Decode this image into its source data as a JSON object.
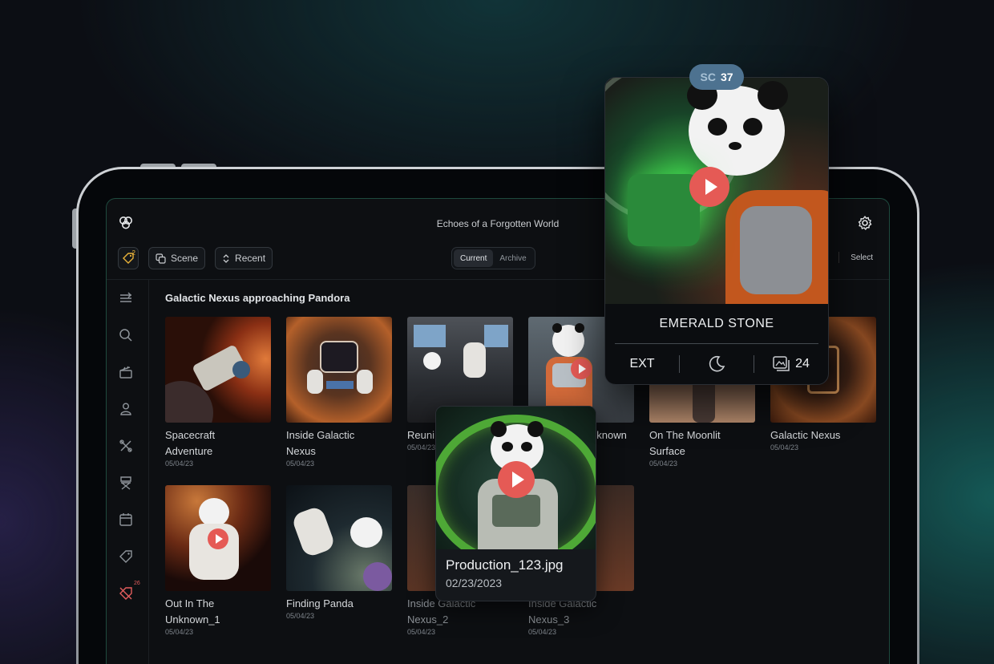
{
  "app": {
    "title": "Echoes of a Forgotten World",
    "tag_badge": "2"
  },
  "toolbar": {
    "scene_label": "Scene",
    "recent_label": "Recent",
    "segments": [
      {
        "label": "Current",
        "active": true
      },
      {
        "label": "Archive",
        "active": false
      }
    ],
    "select_label": "Select"
  },
  "sidebar": {
    "items": [
      {
        "icon": "collapse-icon"
      },
      {
        "icon": "search-icon"
      },
      {
        "icon": "clapperboard-icon"
      },
      {
        "icon": "person-icon"
      },
      {
        "icon": "tools-icon"
      },
      {
        "icon": "director-chair-icon"
      },
      {
        "icon": "calendar-icon"
      },
      {
        "icon": "tag-icon"
      },
      {
        "icon": "untag-icon",
        "badge": "26"
      }
    ]
  },
  "section": {
    "title": "Galactic Nexus approaching Pandora"
  },
  "cards": [
    {
      "title_line1": "Spacecraft",
      "title_line2": "Adventure",
      "date": "05/04/23"
    },
    {
      "title_line1": "Inside Galactic",
      "title_line2": "Nexus",
      "date": "05/04/23"
    },
    {
      "title_line1": "Reuni",
      "title_line2": "",
      "date": "05/04/23"
    },
    {
      "title_line1": "nknown",
      "title_line2": "",
      "date": ""
    },
    {
      "title_line1": "On The Moonlit",
      "title_line2": "Surface",
      "date": "05/04/23"
    },
    {
      "title_line1": "Galactic Nexus",
      "title_line2": "",
      "date": "05/04/23"
    },
    {
      "title_line1": "Out In The",
      "title_line2": "Unknown_1",
      "date": "05/04/23"
    },
    {
      "title_line1": "Finding Panda",
      "title_line2": "",
      "date": "05/04/23"
    },
    {
      "title_line1": "Inside Galactic",
      "title_line2": "Nexus_2",
      "date": "05/04/23"
    },
    {
      "title_line1": "Inside Galactic",
      "title_line2": "Nexus_3",
      "date": "05/04/23"
    }
  ],
  "production_card": {
    "filename": "Production_123.jpg",
    "date": "02/23/2023"
  },
  "scene_card": {
    "scene_label": "SC",
    "scene_number": "37",
    "title": "EMERALD STONE",
    "location": "EXT",
    "time_icon": "moon-icon",
    "image_count": "24"
  },
  "colors": {
    "accent_play": "#e55a55",
    "pill": "#4d7290",
    "badge_red": "#e35d5d"
  }
}
